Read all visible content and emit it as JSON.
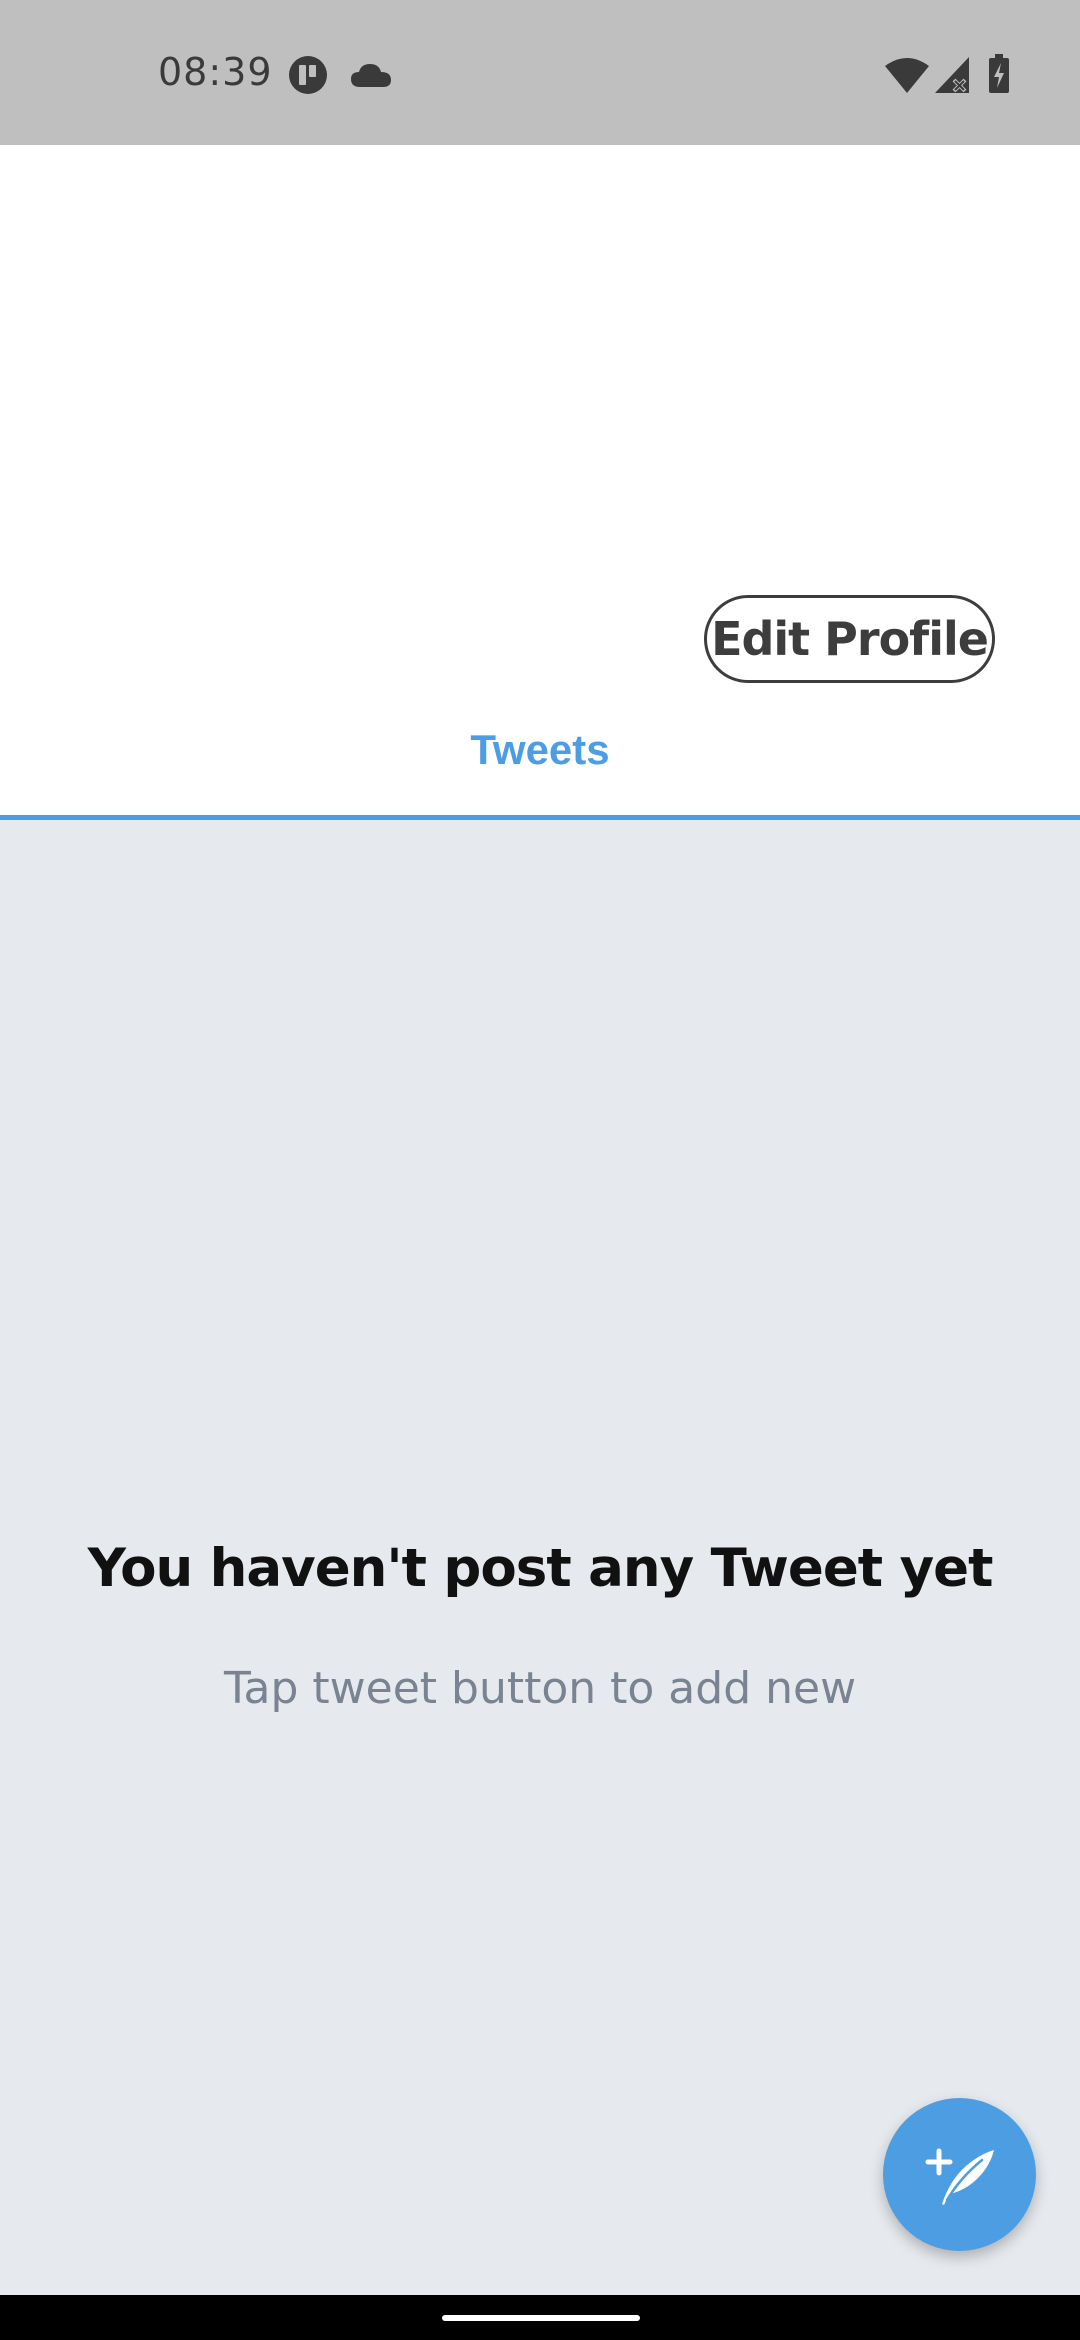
{
  "status_bar": {
    "time": "08:39"
  },
  "profile": {
    "edit_profile_label": "Edit Profile"
  },
  "tabs": {
    "tweets_label": "Tweets"
  },
  "empty_state": {
    "title": "You haven't post any Tweet yet",
    "subtitle": "Tap tweet button to add new"
  },
  "icons": {
    "status": [
      "app-notification-icon",
      "cloud-icon",
      "wifi-icon",
      "signal-icon",
      "battery-charging-icon"
    ],
    "fab": "compose-tweet-icon"
  },
  "colors": {
    "accent": "#4d9de3",
    "status_bar_bg": "#bfbfbf",
    "content_bg": "#e6eaee",
    "subtitle_text": "#7a8392"
  }
}
